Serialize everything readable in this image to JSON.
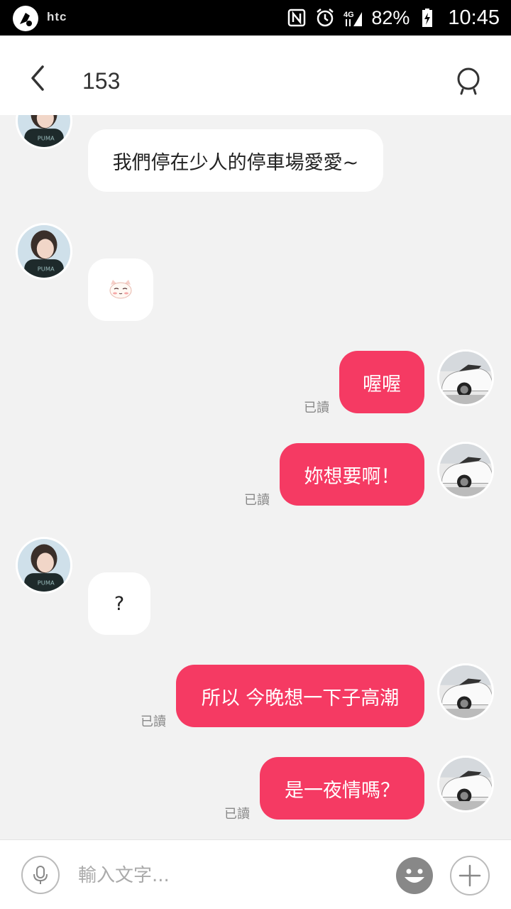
{
  "status_bar": {
    "brand": "htc",
    "battery": "82%",
    "time": "10:45",
    "icons": [
      "nfc-icon",
      "alarm-icon",
      "4g-signal-icon",
      "battery-charging-icon"
    ]
  },
  "header": {
    "title": "153",
    "back_icon": "chevron-left-icon",
    "search_icon": "search-icon"
  },
  "messages": [
    {
      "side": "in",
      "text": "我們停在少人的停車場愛愛~"
    },
    {
      "side": "in",
      "sticker": "cat-sticker-icon"
    },
    {
      "side": "out",
      "text": "喔喔",
      "status": "已讀"
    },
    {
      "side": "out",
      "text": "妳想要啊！",
      "status": "已讀"
    },
    {
      "side": "in",
      "text": "?"
    },
    {
      "side": "out",
      "text": "所以 今晚想一下子高潮",
      "status": "已讀"
    },
    {
      "side": "out",
      "text": "是一夜情嗎？",
      "status": "已讀"
    }
  ],
  "input": {
    "placeholder": "輸入文字...",
    "mic_icon": "microphone-icon",
    "emoji_icon": "emoji-icon",
    "plus_icon": "plus-icon"
  },
  "colors": {
    "outgoing_bubble": "#f53a63",
    "incoming_bubble": "#ffffff",
    "chat_background": "#f2f2f2"
  }
}
